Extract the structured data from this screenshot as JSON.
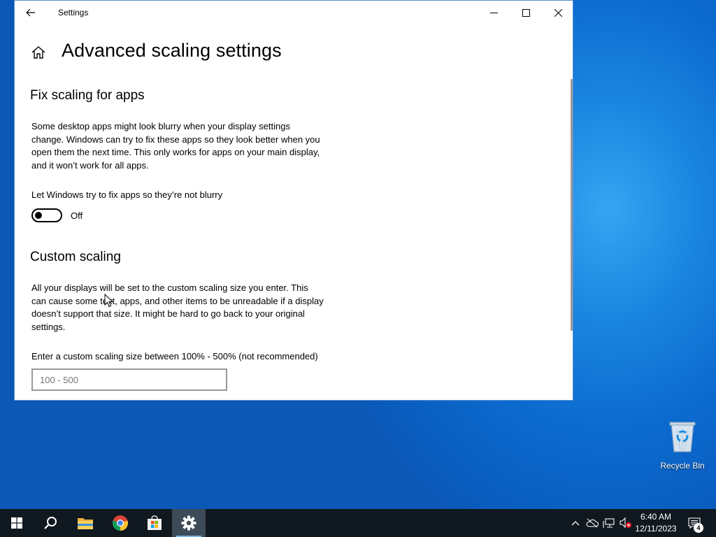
{
  "window": {
    "title": "Settings",
    "page_title": "Advanced scaling settings"
  },
  "fix_scaling": {
    "heading": "Fix scaling for apps",
    "description_lines": [
      "Some desktop apps might look blurry when your display settings",
      "change. Windows can try to fix these apps so they look better when you",
      "open them the next time. This only works for apps on your main display,",
      "and it won’t work for all apps."
    ],
    "toggle_label": "Let Windows try to fix apps so they’re not blurry",
    "toggle_state": "Off",
    "toggle_on": false
  },
  "custom_scaling": {
    "heading": "Custom scaling",
    "description_lines": [
      "All your displays will be set to the custom scaling size you enter. This",
      "can cause some text, apps, and other items to be unreadable if a display",
      "doesn’t support that size. It might be hard to go back to your original",
      "settings."
    ],
    "input_label": "Enter a custom scaling size between 100% - 500% (not recommended)",
    "input_placeholder": "100 - 500",
    "input_value": ""
  },
  "desktop": {
    "recycle_bin_label": "Recycle Bin"
  },
  "taskbar": {
    "pinned": [
      "start-icon",
      "search-icon",
      "file-explorer-icon",
      "chrome-icon",
      "microsoft-store-icon",
      "settings-icon"
    ],
    "time": "6:40 AM",
    "date": "12/11/2023",
    "notification_count": "4"
  },
  "colors": {
    "taskbar": "#101820",
    "accent": "#76b9ed",
    "desktop": "#0c6bcf"
  }
}
